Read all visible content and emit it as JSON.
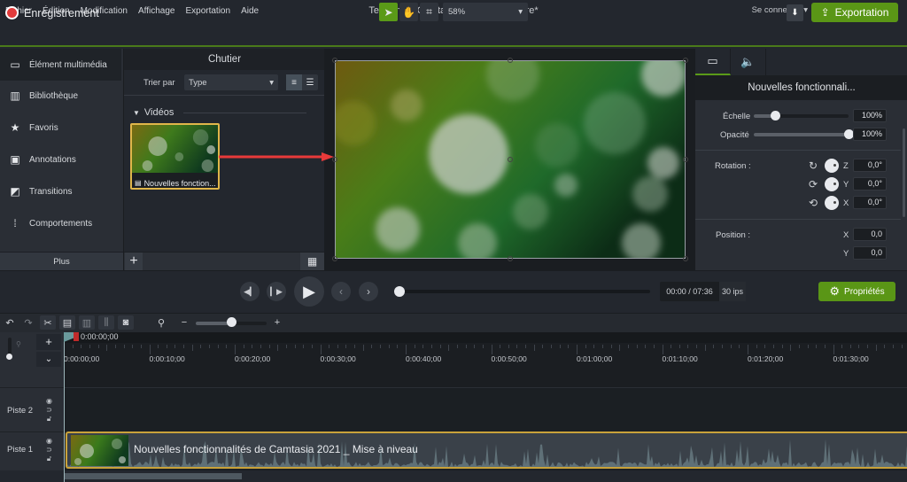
{
  "window": {
    "title": "TechSmith Camtasia - Projet sans titre*",
    "sign_in": "Se connecter",
    "minimize": "—",
    "maximize": "❐",
    "close": "✕"
  },
  "menu": [
    "Fichier",
    "Édition",
    "Modification",
    "Affichage",
    "Exportation",
    "Aide"
  ],
  "toolbar": {
    "record_label": "Enregistrement",
    "zoom_value": "58%",
    "export_label": "Exportation",
    "tools": [
      "select-icon",
      "hand-pan-icon",
      "crop-icon"
    ]
  },
  "sidebar": {
    "items": [
      {
        "label": "Élément multimédia",
        "icon": "media-icon",
        "active": true
      },
      {
        "label": "Bibliothèque",
        "icon": "library-icon"
      },
      {
        "label": "Favoris",
        "icon": "star-icon"
      },
      {
        "label": "Annotations",
        "icon": "annotations-icon"
      },
      {
        "label": "Transitions",
        "icon": "transitions-icon"
      },
      {
        "label": "Comportements",
        "icon": "behaviors-icon"
      }
    ],
    "more_label": "Plus"
  },
  "bin": {
    "title": "Chutier",
    "sort_label": "Trier par",
    "sort_value": "Type",
    "section_label": "Vidéos",
    "item_label": "Nouvelles fonction..."
  },
  "properties": {
    "tabs": [
      "visual-properties-icon",
      "audio-properties-icon"
    ],
    "title": "Nouvelles fonctionnali...",
    "scale_label": "Échelle",
    "scale_value": "100%",
    "scale_fraction": 0.22,
    "opacity_label": "Opacité",
    "opacity_value": "100%",
    "opacity_fraction": 1.0,
    "rotation_label": "Rotation :",
    "rotation": [
      {
        "axis": "Z",
        "value": "0,0°"
      },
      {
        "axis": "Y",
        "value": "0,0°"
      },
      {
        "axis": "X",
        "value": "0,0°"
      }
    ],
    "position_label": "Position :",
    "position": [
      {
        "axis": "X",
        "value": "0,0"
      },
      {
        "axis": "Y",
        "value": "0,0"
      }
    ]
  },
  "playback": {
    "time": "00:00 / 07:36",
    "fps": "30 ips",
    "progress": 0.0,
    "properties_label": "Propriétés"
  },
  "timeline": {
    "playhead_time": "0:00:00;00",
    "zoom_fraction": 0.5,
    "ruler_labels": [
      "0:00:00;00",
      "0:00:10;00",
      "0:00:20;00",
      "0:00:30;00",
      "0:00:40;00",
      "0:00:50;00",
      "0:01:00;00",
      "0:01:10;00",
      "0:01:20;00",
      "0:01:30;00"
    ],
    "tracks": [
      {
        "name": "Piste 2"
      },
      {
        "name": "Piste 1",
        "clip": "Nouvelles fonctionnalités de Camtasia 2021 _ Mise à niveau"
      }
    ]
  },
  "colors": {
    "accent_green": "#5a9616",
    "record_red": "#e23b3b",
    "selection_gold": "#c9a23a",
    "annotation_arrow": "#e83a3a"
  }
}
